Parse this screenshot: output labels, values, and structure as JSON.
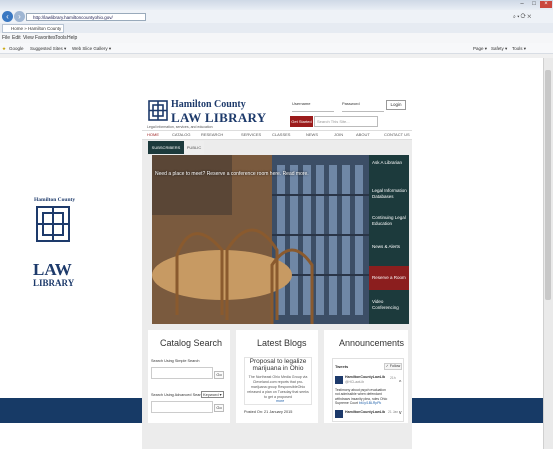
{
  "browser": {
    "url": "http://lawlibrary.hamiltoncountyohio.gov/",
    "tab_label": "Home » Hamilton County L...",
    "menus": [
      "File",
      "Edit",
      "View",
      "Favorites",
      "Tools",
      "Help"
    ],
    "favorites": [
      "Google",
      "Suggested Sites ▾",
      "Web Slice Gallery ▾"
    ],
    "commands": [
      "Page ▾",
      "Safety ▾",
      "Tools ▾"
    ],
    "back_icon": "back-arrow-icon",
    "forward_icon": "forward-arrow-icon"
  },
  "header": {
    "title_line1": "Hamilton County",
    "title_line2": "LAW LIBRARY",
    "tagline": "Legal information, services, and education",
    "username_label": "Username",
    "password_label": "Password",
    "login_label": "Login",
    "get_started_label": "Get Started",
    "search_placeholder": "Search This Site..."
  },
  "nav": [
    "HOME",
    "CATALOG",
    "RESEARCH",
    "SERVICES",
    "CLASSES",
    "NEWS",
    "JOIN",
    "ABOUT",
    "CONTACT US"
  ],
  "subtabs": [
    "SUBSCRIBERS",
    "PUBLIC"
  ],
  "hero": {
    "caption": "Need a place to meet? Reserve a conference room here. Read more."
  },
  "sidenav": [
    "Ask A Librarian",
    "Legal Information Databases",
    "Continuing Legal Education",
    "News & Alerts",
    "Reserve a Room",
    "Video Conferencing"
  ],
  "catalog": {
    "title": "Catalog Search",
    "simple_label": "Search Using Simple Search",
    "advanced_label": "Search Using Advanced Search",
    "advanced_option": "Keyword",
    "go_label": "Go"
  },
  "blogs": {
    "title": "Latest Blogs",
    "post_title": "Proposal to legalize marijuana in Ohio",
    "post_body": "The Northeast Ohio Media Group via Cleveland.com reports that pro-marijuana group ResponsibleOhio released a plan on Tuesday that seeks to get a proposed",
    "more_label": "more",
    "posted": "Posted On: 21 January 2015"
  },
  "announcements": {
    "title": "Announcements",
    "tweets_label": "Tweets",
    "follow_label": "Follow",
    "tweet1_user": "HamiltonCountyLawLib",
    "tweet1_handle": "@HCLawLib",
    "tweet1_time": "21h",
    "tweet1_body": "Testimony about psych evaluation not admissible when defendant withdraws insanity plea, rules Ohio Supreme Court",
    "tweet1_link": "bit.ly/1BLRpPk",
    "tweet2_user": "HamiltonCountyLawLib",
    "tweet2_time": "21 Jan"
  },
  "left_logo": {
    "line1": "Hamilton County",
    "line2": "LAW",
    "line3": "LIBRARY"
  },
  "colors": {
    "brand_navy": "#1d3a6b",
    "accent_red": "#9b1b1b",
    "side_teal": "#1c3a3c",
    "footer_blue": "#173a66"
  }
}
